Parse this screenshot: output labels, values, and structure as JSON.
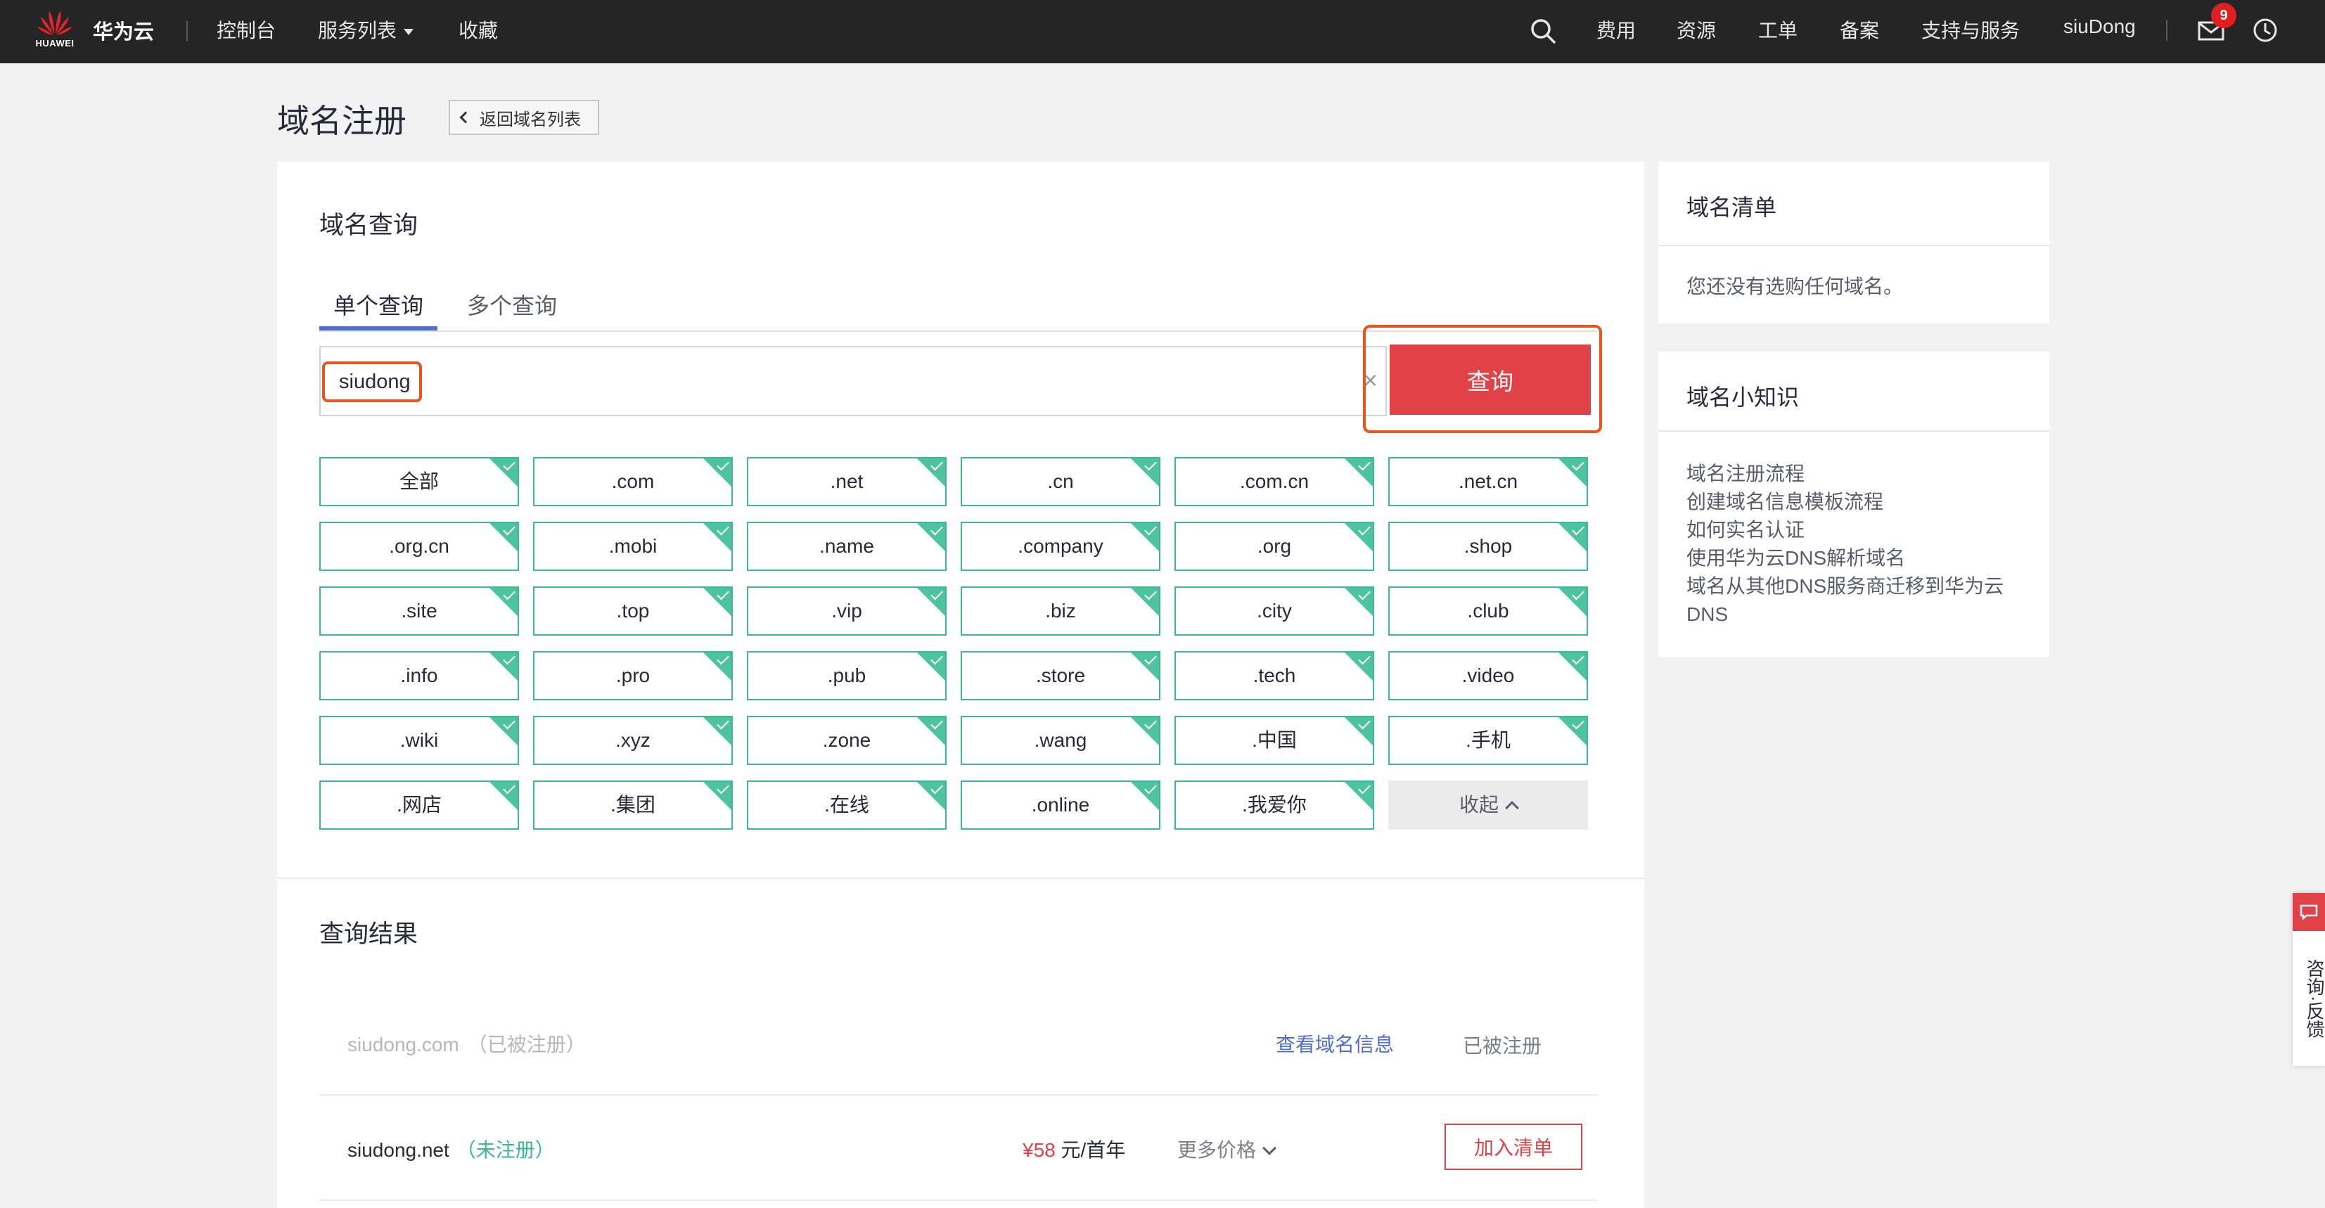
{
  "nav": {
    "logo_sub": "HUAWEI",
    "brand": "华为云",
    "console": "控制台",
    "services": "服务列表",
    "favorites": "收藏",
    "fees": "费用",
    "resources": "资源",
    "tickets": "工单",
    "filing": "备案",
    "support": "支持与服务",
    "user": "siuDong",
    "mail_badge": "9"
  },
  "page": {
    "title": "域名注册",
    "back_label": "返回域名列表"
  },
  "query": {
    "section_title": "域名查询",
    "tab_single": "单个查询",
    "tab_multi": "多个查询",
    "input_value": "siudong",
    "clear": "×",
    "button_label": "查询"
  },
  "tlds": [
    "全部",
    ".com",
    ".net",
    ".cn",
    ".com.cn",
    ".net.cn",
    ".org.cn",
    ".mobi",
    ".name",
    ".company",
    ".org",
    ".shop",
    ".site",
    ".top",
    ".vip",
    ".biz",
    ".city",
    ".club",
    ".info",
    ".pro",
    ".pub",
    ".store",
    ".tech",
    ".video",
    ".wiki",
    ".xyz",
    ".zone",
    ".wang",
    ".中国",
    ".手机",
    ".网店",
    ".集团",
    ".在线",
    ".online",
    ".我爱你"
  ],
  "collapse_label": "收起",
  "results": {
    "section_title": "查询结果",
    "rows": [
      {
        "domain": "siudong.com",
        "status": "（已被注册）",
        "link": "查看域名信息",
        "state": "已被注册"
      },
      {
        "domain": "siudong.net",
        "status": "（未注册）",
        "price_amount": "¥58",
        "price_unit": " 元/首年",
        "more_price": "更多价格",
        "add_button": "加入清单"
      }
    ]
  },
  "sidebar": {
    "list_title": "域名清单",
    "list_empty": "您还没有选购任何域名。",
    "knowledge_title": "域名小知识",
    "knowledge_links": [
      "域名注册流程",
      "创建域名信息模板流程",
      "如何实名认证",
      "使用华为云DNS解析域名",
      "域名从其他DNS服务商迁移到华为云",
      "DNS"
    ]
  },
  "feedback": {
    "label": "咨询·反馈"
  },
  "colors": {
    "accent_red": "#e04247",
    "highlight_orange": "#e9541f",
    "chip_green": "#3eb698",
    "link_blue": "#526ecc",
    "nav_bg": "#252525"
  }
}
